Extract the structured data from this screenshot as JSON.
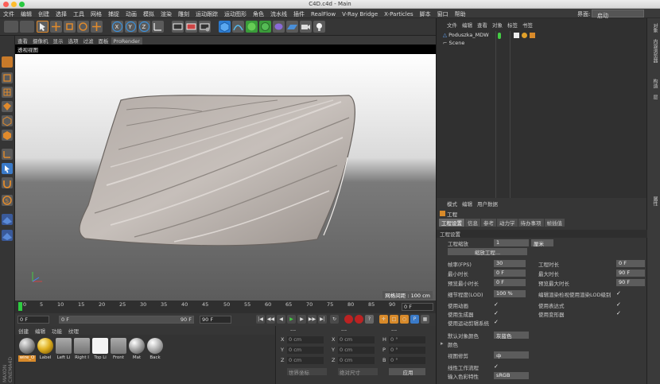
{
  "window": {
    "title": "C4D.c4d - Main"
  },
  "menubar": [
    "文件",
    "编辑",
    "创建",
    "选择",
    "工具",
    "网格",
    "捕捉",
    "动画",
    "模拟",
    "渲染",
    "雕刻",
    "运动跟踪",
    "运动图形",
    "角色",
    "流水线",
    "插件",
    "RealFlow",
    "V-Ray Bridge",
    "X-Particles",
    "脚本",
    "窗口",
    "帮助"
  ],
  "layout": {
    "label": "界面:",
    "value": "启动"
  },
  "viewport": {
    "menu": [
      "查看",
      "摄像机",
      "显示",
      "选项",
      "过滤",
      "面板",
      "ProRender"
    ],
    "title": "透视视图",
    "grid_info": "网格间距 : 100 cm"
  },
  "timeline": {
    "ticks": [
      "0",
      "5",
      "10",
      "15",
      "20",
      "25",
      "30",
      "35",
      "40",
      "45",
      "50",
      "55",
      "60",
      "65",
      "70",
      "75",
      "80",
      "85",
      "90"
    ],
    "current_frame": "0 F"
  },
  "transport": {
    "start": "0 F",
    "field2": "0 F",
    "end": "90 F",
    "end2": "90 F"
  },
  "materials": {
    "menu": [
      "创建",
      "编辑",
      "功能",
      "纹理"
    ],
    "items": [
      {
        "name": "wire_O",
        "color": "#9a9a9a"
      },
      {
        "name": "Label",
        "color": "#e0b020"
      },
      {
        "name": "Left Li",
        "color": "#8c8c8c"
      },
      {
        "name": "Right I",
        "color": "#8a8a8a"
      },
      {
        "name": "Top Li",
        "color": "#f4f4f4"
      },
      {
        "name": "Front",
        "color": "#8e8e8e"
      },
      {
        "name": "Mat",
        "color": "#a8a8a8"
      },
      {
        "name": "Back",
        "color": "#b5b5b5"
      }
    ]
  },
  "coordinates": {
    "header": [
      "---",
      "---",
      "---"
    ],
    "rows": [
      {
        "a": "X",
        "av": "0 cm",
        "b": "X",
        "bv": "0 cm",
        "c": "H",
        "cv": "0 °"
      },
      {
        "a": "Y",
        "av": "0 cm",
        "b": "Y",
        "bv": "0 cm",
        "c": "P",
        "cv": "0 °"
      },
      {
        "a": "Z",
        "av": "0 cm",
        "b": "Z",
        "bv": "0 cm",
        "c": "B",
        "cv": "0 °"
      }
    ],
    "space": "世界坐标",
    "scale_mode": "绝对尺寸",
    "apply": "应用"
  },
  "object_manager": {
    "menu": [
      "文件",
      "编辑",
      "查看",
      "对象",
      "标签",
      "书签"
    ],
    "objects": [
      "Poduszka_MDW",
      "Scene"
    ]
  },
  "side_tabs": [
    "对象",
    "内容浏览器",
    "构造",
    "层",
    "属性"
  ],
  "attributes": {
    "menu": [
      "模式",
      "编辑",
      "用户数据"
    ],
    "object_title": "工程",
    "tabs": [
      "工程设置",
      "信息",
      "参考",
      "动力学",
      "待办事项",
      "帧插值"
    ],
    "section": "工程设置",
    "scale_label": "工程缩放",
    "scale_value": "1",
    "scale_unit": "厘米",
    "scale_button": "缩放工程...",
    "fps_label": "帧率(FPS)",
    "fps_value": "30",
    "min_label": "最小时长",
    "min_value": "0 F",
    "preview_min_label": "预览最小时长",
    "preview_min_value": "0 F",
    "lod_label": "细节程度(LOD)",
    "lod_value": "100 %",
    "time_label": "工程时长",
    "time_value": "0 F",
    "max_label": "最大时长",
    "max_value": "90 F",
    "preview_max_label": "预览最大时长",
    "preview_max_value": "90 F",
    "render_lod_label": "编辑渲染检视使用渲染LOD级别",
    "anim_label": "使用动画",
    "expr_label": "使用表达式",
    "gen_label": "使用生成器",
    "deform_label": "使用变形器",
    "motion_label": "使用运动剪辑系统",
    "default_color_label": "默认对象颜色",
    "default_color_value": "灰蓝色",
    "color_label": "颜色",
    "clip_label": "视图修剪",
    "clip_value": "中",
    "linear_label": "线性工作流程",
    "input_label": "输入色彩特性",
    "input_value": "sRGB"
  }
}
